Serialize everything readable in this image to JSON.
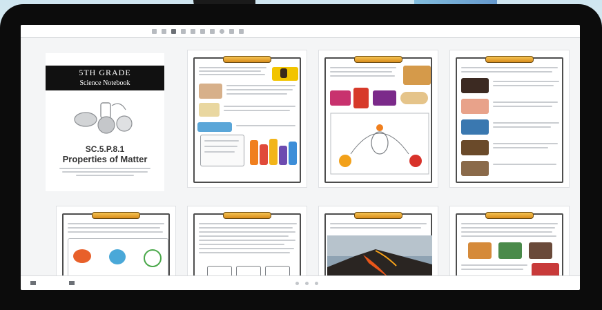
{
  "viewer": {
    "toolbar": {
      "menu": [
        "",
        "",
        "",
        ""
      ]
    },
    "pages": [
      {
        "cover": {
          "bar_line1": "5TH GRADE",
          "bar_line2": "Science Notebook",
          "code": "SC.5.P.8.1",
          "title": "Properties of Matter"
        }
      },
      {
        "label": ""
      },
      {
        "label": ""
      },
      {
        "label": ""
      },
      {
        "label": ""
      },
      {
        "label": ""
      },
      {
        "label": ""
      },
      {
        "label": ""
      }
    ]
  },
  "colors": {
    "banner": "#e9a93a",
    "frame": "#4d4d4d",
    "bezel": "#0c0c0c",
    "viewer_bg": "#f4f5f6"
  }
}
